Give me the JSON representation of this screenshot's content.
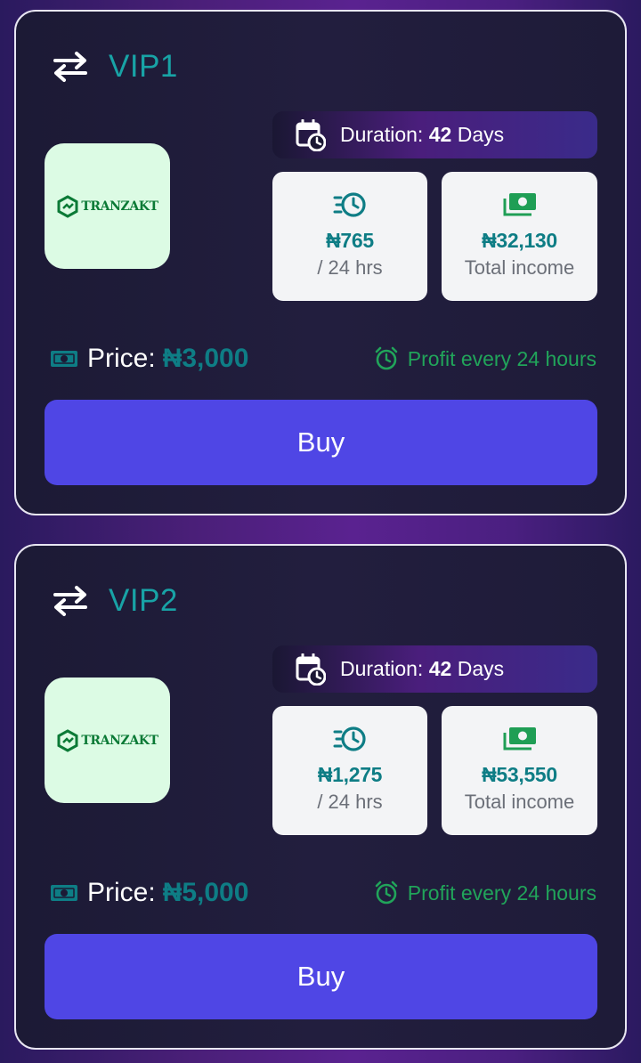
{
  "colors": {
    "accent": "#4f46e5",
    "teal": "#0e7d85",
    "plan_name": "#18a3a6",
    "profit_green": "#21a45a",
    "logo_bg": "#dcfbe4"
  },
  "plans": [
    {
      "name": "VIP1",
      "logo_text": "TRANZAKT",
      "duration_label": "Duration:",
      "duration_value": "42",
      "duration_unit": "Days",
      "daily_amount": "₦765",
      "daily_label": "/ 24 hrs",
      "total_amount": "₦32,130",
      "total_label": "Total income",
      "price_label": "Price:",
      "price_value": "₦3,000",
      "profit_text": "Profit every 24 hours",
      "buy_label": "Buy"
    },
    {
      "name": "VIP2",
      "logo_text": "TRANZAKT",
      "duration_label": "Duration:",
      "duration_value": "42",
      "duration_unit": "Days",
      "daily_amount": "₦1,275",
      "daily_label": "/ 24 hrs",
      "total_amount": "₦53,550",
      "total_label": "Total income",
      "price_label": "Price:",
      "price_value": "₦5,000",
      "profit_text": "Profit every 24 hours",
      "buy_label": "Buy"
    }
  ],
  "icons": {
    "header": "swap-arrows-icon",
    "duration": "calendar-clock-icon",
    "daily": "fast-clock-icon",
    "total": "money-stack-icon",
    "price": "cash-icon",
    "profit": "alarm-clock-icon"
  }
}
